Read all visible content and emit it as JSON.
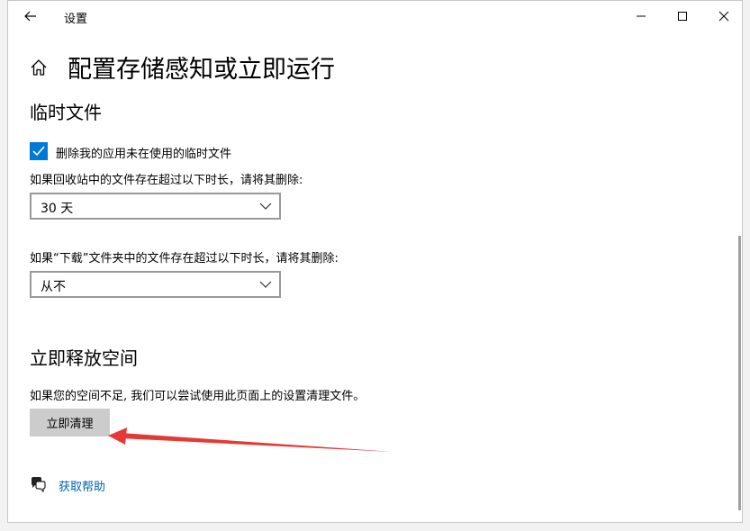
{
  "window": {
    "title": "设置"
  },
  "page": {
    "title": "配置存储感知或立即运行"
  },
  "temp_files": {
    "heading": "临时文件",
    "checkbox_label": "删除我的应用未在使用的临时文件",
    "checkbox_checked": true,
    "recycle_label": "如果回收站中的文件存在超过以下时长，请将其删除:",
    "recycle_value": "30 天",
    "downloads_label": "如果“下载”文件夹中的文件存在超过以下时长，请将其删除:",
    "downloads_value": "从不"
  },
  "free_space": {
    "heading": "立即释放空间",
    "description": "如果您的空间不足, 我们可以尝试使用此页面上的设置清理文件。",
    "button_label": "立即清理"
  },
  "help": {
    "link_label": "获取帮助"
  },
  "colors": {
    "accent": "#0078d7",
    "link": "#0063b1",
    "annotation_arrow": "#e53935"
  },
  "icons": [
    "back-arrow-icon",
    "minimize-icon",
    "maximize-icon",
    "close-icon",
    "home-icon",
    "checkmark-icon",
    "chevron-down-icon",
    "help-chat-icon"
  ]
}
